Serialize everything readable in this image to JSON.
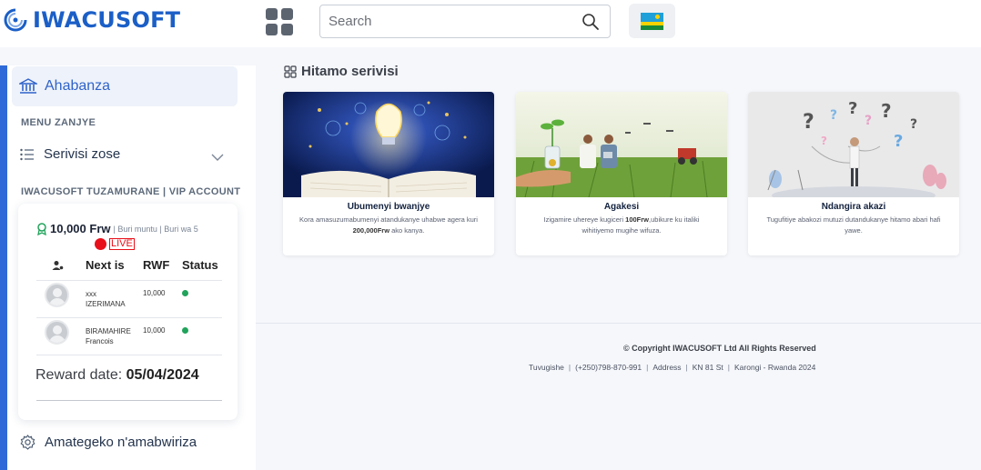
{
  "brand": {
    "name": "IWACUSOFT"
  },
  "search": {
    "placeholder": "Search"
  },
  "sidebar": {
    "home_label": "Ahabanza",
    "menu_section": "MENU ZANJYE",
    "all_services_label": "Serivisi zose",
    "vip_section": "IWACUSOFT TUZAMURANE | VIP ACCOUNT",
    "rules_label": "Amategeko n'amabwiriza"
  },
  "vip": {
    "amount": "10,000 Frw",
    "meta": "| Buri muntu | Buri wa 5",
    "live": "LIVE",
    "headers": {
      "next": "Next is",
      "rwf": "RWF",
      "status": "Status"
    },
    "rows": [
      {
        "name_line1": "xxx",
        "name_line2": "IZERIMANA",
        "amount": "10,000"
      },
      {
        "name_line1": "BIRAMAHIRE",
        "name_line2": "Francois",
        "amount": "10,000"
      }
    ],
    "reward_label": "Reward date:",
    "reward_date": "05/04/2024"
  },
  "main": {
    "title": "Hitamo serivisi",
    "services": [
      {
        "title": "Ubumenyi bwanjye",
        "desc_pre": "Kora amasuzumabumenyi atandukanye uhabwe agera kuri ",
        "desc_bold": "200,000Frw",
        "desc_post": " ako kanya."
      },
      {
        "title": "Agakesi",
        "desc_pre": "Izigamire uhereye kugiceri ",
        "desc_bold": "100Frw",
        "desc_post": ",ubikure ku italiki wihitiyemo mugihe wifuza."
      },
      {
        "title": "Ndangira akazi",
        "desc_pre": "Tugufitiye abakozi mutuzi dutandukanye hitamo abari hafi yawe.",
        "desc_bold": "",
        "desc_post": ""
      }
    ]
  },
  "footer": {
    "copyright": "© Copyright IWACUSOFT Ltd   All Rights Reserved",
    "contact_label": "Tuvugishe",
    "phone": "(+250)798-870-991",
    "address_label": "Address",
    "street": "KN 81 St",
    "location": "Karongi - Rwanda 2024"
  },
  "colors": {
    "brand": "#1b5fc7",
    "accent": "#2f6bd8",
    "live": "#e8101a",
    "success": "#21a35b"
  },
  "icons": [
    "logo-icon",
    "apps-grid-icon",
    "search-icon",
    "rwanda-flag-icon",
    "bank-icon",
    "list-icon",
    "chevron-down-icon",
    "award-icon",
    "user-icon",
    "check-icon",
    "gear-icon",
    "grid-icon"
  ]
}
